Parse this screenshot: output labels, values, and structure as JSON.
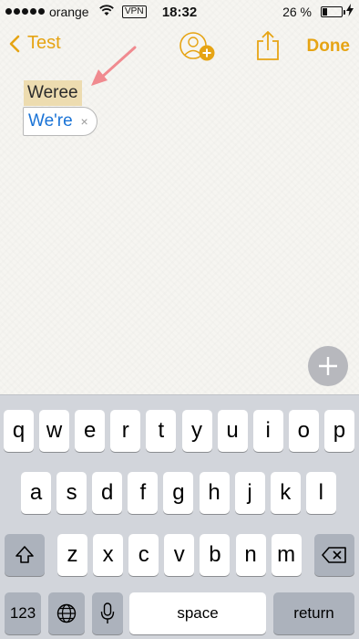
{
  "status_bar": {
    "carrier": "orange",
    "vpn": "VPN",
    "time": "18:32",
    "battery_percent": "26 %",
    "battery_level": 0.26,
    "signal_bars": 5
  },
  "nav": {
    "back_label": "Test",
    "done_label": "Done",
    "accent_color": "#e6a414"
  },
  "note": {
    "word": "Weree",
    "suggestion": "We're",
    "dismiss": "×"
  },
  "keyboard": {
    "row1": [
      "q",
      "w",
      "e",
      "r",
      "t",
      "y",
      "u",
      "i",
      "o",
      "p"
    ],
    "row2": [
      "a",
      "s",
      "d",
      "f",
      "g",
      "h",
      "j",
      "k",
      "l"
    ],
    "row3": [
      "z",
      "x",
      "c",
      "v",
      "b",
      "n",
      "m"
    ],
    "numbers_label": "123",
    "space_label": "space",
    "return_label": "return"
  }
}
